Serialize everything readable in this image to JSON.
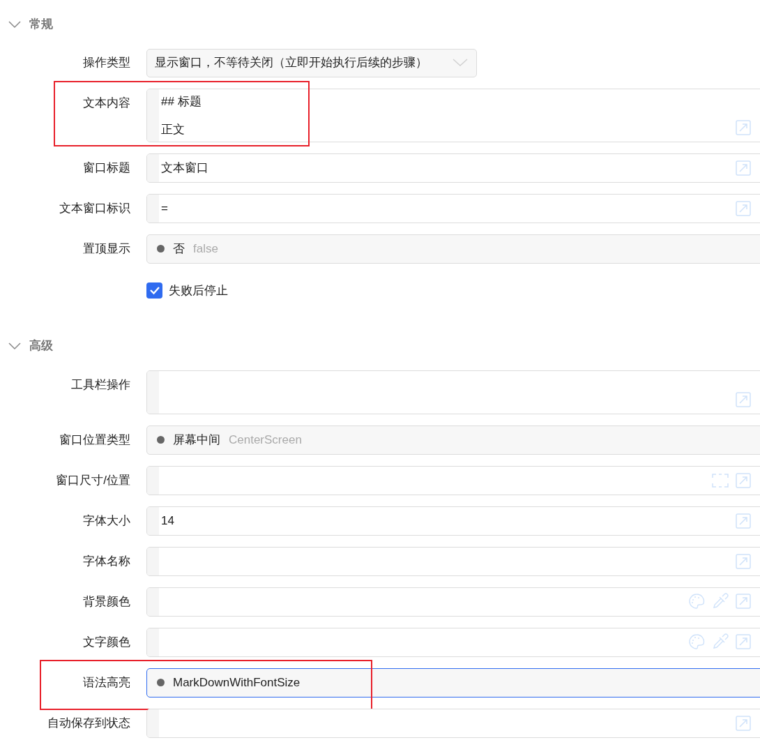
{
  "sections": [
    {
      "title": "常规",
      "expanded": true,
      "rows": [
        {
          "kind": "select",
          "label": "操作类型",
          "value": "显示窗口，不等待关闭（立即开始执行后续的步骤）"
        },
        {
          "kind": "textarea",
          "label": "文本内容",
          "lines": [
            "## 标题",
            "正文"
          ],
          "highlighted": true
        },
        {
          "kind": "text",
          "label": "窗口标题",
          "value": "文本窗口"
        },
        {
          "kind": "text",
          "label": "文本窗口标识",
          "value": "="
        },
        {
          "kind": "enum",
          "label": "置顶显示",
          "value": "否",
          "hint": "false"
        },
        {
          "kind": "checkbox",
          "label": "失败后停止",
          "checked": true
        }
      ]
    },
    {
      "title": "高级",
      "expanded": true,
      "rows": [
        {
          "kind": "tall",
          "label": "工具栏操作"
        },
        {
          "kind": "enum",
          "label": "窗口位置类型",
          "value": "屏幕中间",
          "hint": "CenterScreen"
        },
        {
          "kind": "rect",
          "label": "窗口尺寸/位置"
        },
        {
          "kind": "text",
          "label": "字体大小",
          "value": "14"
        },
        {
          "kind": "text",
          "label": "字体名称"
        },
        {
          "kind": "color",
          "label": "背景颜色"
        },
        {
          "kind": "color",
          "label": "文字颜色"
        },
        {
          "kind": "enum",
          "label": "语法高亮",
          "value": "MarkDownWithFontSize",
          "highlighted": true,
          "focused": true
        },
        {
          "kind": "text",
          "label": "自动保存到状态"
        }
      ]
    }
  ]
}
